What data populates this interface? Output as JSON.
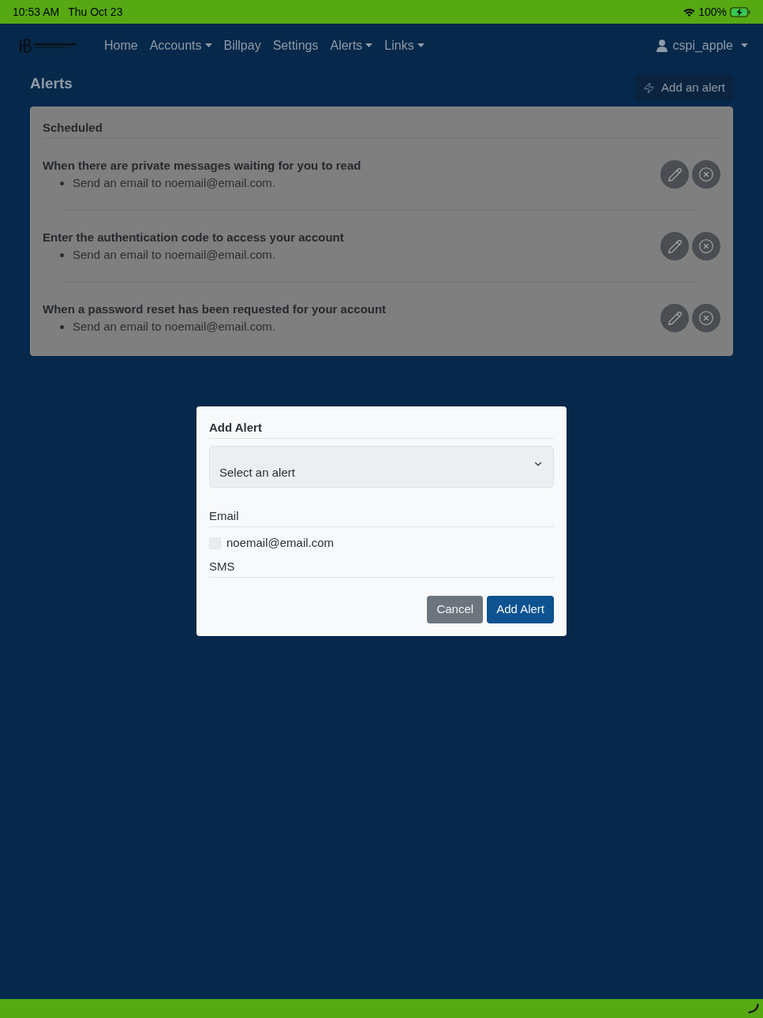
{
  "status_bar": {
    "time": "10:53 AM",
    "date": "Thu Oct 23",
    "battery": "100%",
    "charging": true
  },
  "navbar": {
    "items": [
      {
        "label": "Home",
        "dropdown": false
      },
      {
        "label": "Accounts",
        "dropdown": true
      },
      {
        "label": "Billpay",
        "dropdown": false
      },
      {
        "label": "Settings",
        "dropdown": false
      },
      {
        "label": "Alerts",
        "dropdown": true
      },
      {
        "label": "Links",
        "dropdown": true
      }
    ],
    "user": {
      "label": "cspi_apple",
      "dropdown": true
    }
  },
  "page": {
    "title": "Alerts",
    "add_button": "Add an alert"
  },
  "scheduled": {
    "title": "Scheduled",
    "alerts": [
      {
        "title": "When there are private messages waiting for you to read",
        "actions": [
          "Send an email to noemail@email.com."
        ]
      },
      {
        "title": "Enter the authentication code to access your account",
        "actions": [
          "Send an email to noemail@email.com."
        ]
      },
      {
        "title": "When a password reset has been requested for your account",
        "actions": [
          "Send an email to noemail@email.com."
        ]
      }
    ]
  },
  "modal": {
    "title": "Add Alert",
    "select": {
      "placeholder": "Select an alert"
    },
    "email": {
      "label": "Email",
      "options": [
        {
          "label": "noemail@email.com",
          "checked": false
        }
      ]
    },
    "sms": {
      "label": "SMS"
    },
    "buttons": [
      {
        "label": "Cancel",
        "kind": "secondary"
      },
      {
        "label": "Add Alert",
        "kind": "primary"
      }
    ]
  }
}
